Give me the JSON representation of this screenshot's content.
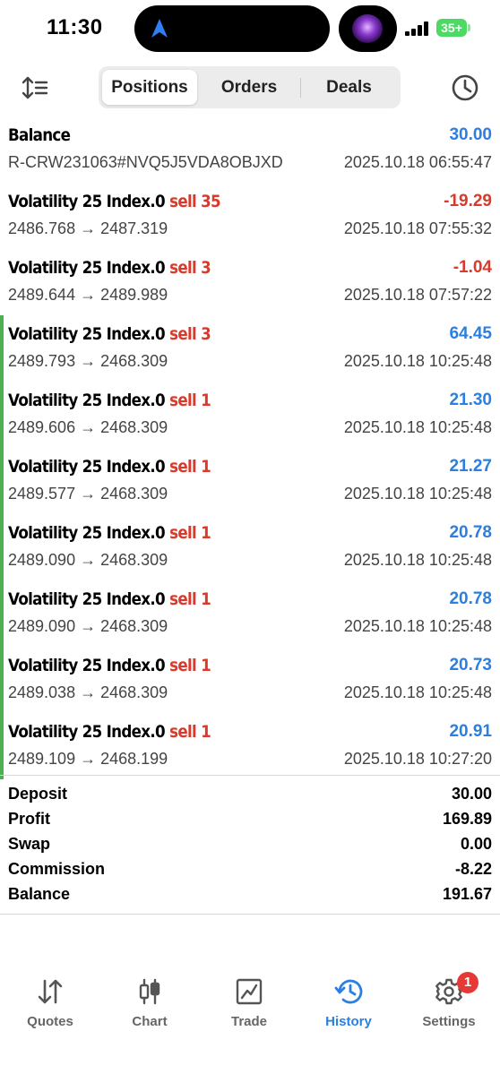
{
  "status_bar": {
    "time": "11:30",
    "battery": "35+"
  },
  "tabs": [
    {
      "label": "Positions",
      "active": true
    },
    {
      "label": "Orders",
      "active": false
    },
    {
      "label": "Deals",
      "active": false
    }
  ],
  "balance_entry": {
    "title": "Balance",
    "value": "30.00",
    "id": "R-CRW231063#NVQ5J5VDA8OBJXD",
    "time": "2025.10.18 06:55:47"
  },
  "deals": [
    {
      "symbol": "Volatility 25 Index.0",
      "side": "sell 35",
      "profit": "-19.29",
      "prices": "2486.768 → 2487.319",
      "time": "2025.10.18 07:55:32",
      "closed_group": false
    },
    {
      "symbol": "Volatility 25 Index.0",
      "side": "sell 3",
      "profit": "-1.04",
      "prices": "2489.644 → 2489.989",
      "time": "2025.10.18 07:57:22",
      "closed_group": false
    },
    {
      "symbol": "Volatility 25 Index.0",
      "side": "sell 3",
      "profit": "64.45",
      "prices": "2489.793 → 2468.309",
      "time": "2025.10.18 10:25:48",
      "closed_group": true
    },
    {
      "symbol": "Volatility 25 Index.0",
      "side": "sell 1",
      "profit": "21.30",
      "prices": "2489.606 → 2468.309",
      "time": "2025.10.18 10:25:48",
      "closed_group": true
    },
    {
      "symbol": "Volatility 25 Index.0",
      "side": "sell 1",
      "profit": "21.27",
      "prices": "2489.577 → 2468.309",
      "time": "2025.10.18 10:25:48",
      "closed_group": true
    },
    {
      "symbol": "Volatility 25 Index.0",
      "side": "sell 1",
      "profit": "20.78",
      "prices": "2489.090 → 2468.309",
      "time": "2025.10.18 10:25:48",
      "closed_group": true
    },
    {
      "symbol": "Volatility 25 Index.0",
      "side": "sell 1",
      "profit": "20.78",
      "prices": "2489.090 → 2468.309",
      "time": "2025.10.18 10:25:48",
      "closed_group": true
    },
    {
      "symbol": "Volatility 25 Index.0",
      "side": "sell 1",
      "profit": "20.73",
      "prices": "2489.038 → 2468.309",
      "time": "2025.10.18 10:25:48",
      "closed_group": true
    },
    {
      "symbol": "Volatility 25 Index.0",
      "side": "sell 1",
      "profit": "20.91",
      "prices": "2489.109 → 2468.199",
      "time": "2025.10.18 10:27:20",
      "closed_group": true
    }
  ],
  "summary": [
    {
      "label": "Deposit",
      "value": "30.00"
    },
    {
      "label": "Profit",
      "value": "169.89"
    },
    {
      "label": "Swap",
      "value": "0.00"
    },
    {
      "label": "Commission",
      "value": "-8.22"
    },
    {
      "label": "Balance",
      "value": "191.67"
    }
  ],
  "bottom_nav": [
    {
      "label": "Quotes",
      "icon": "quotes-arrows-icon",
      "active": false
    },
    {
      "label": "Chart",
      "icon": "candlestick-icon",
      "active": false
    },
    {
      "label": "Trade",
      "icon": "trade-chart-icon",
      "active": false
    },
    {
      "label": "History",
      "icon": "history-clock-icon",
      "active": true
    },
    {
      "label": "Settings",
      "icon": "gear-icon",
      "active": false,
      "badge": "1"
    }
  ],
  "colors": {
    "positive": "#2a7fe0",
    "negative": "#d93a2b",
    "accent": "#2a7fe0",
    "group_bar": "#4caf50",
    "badge": "#e53935"
  }
}
